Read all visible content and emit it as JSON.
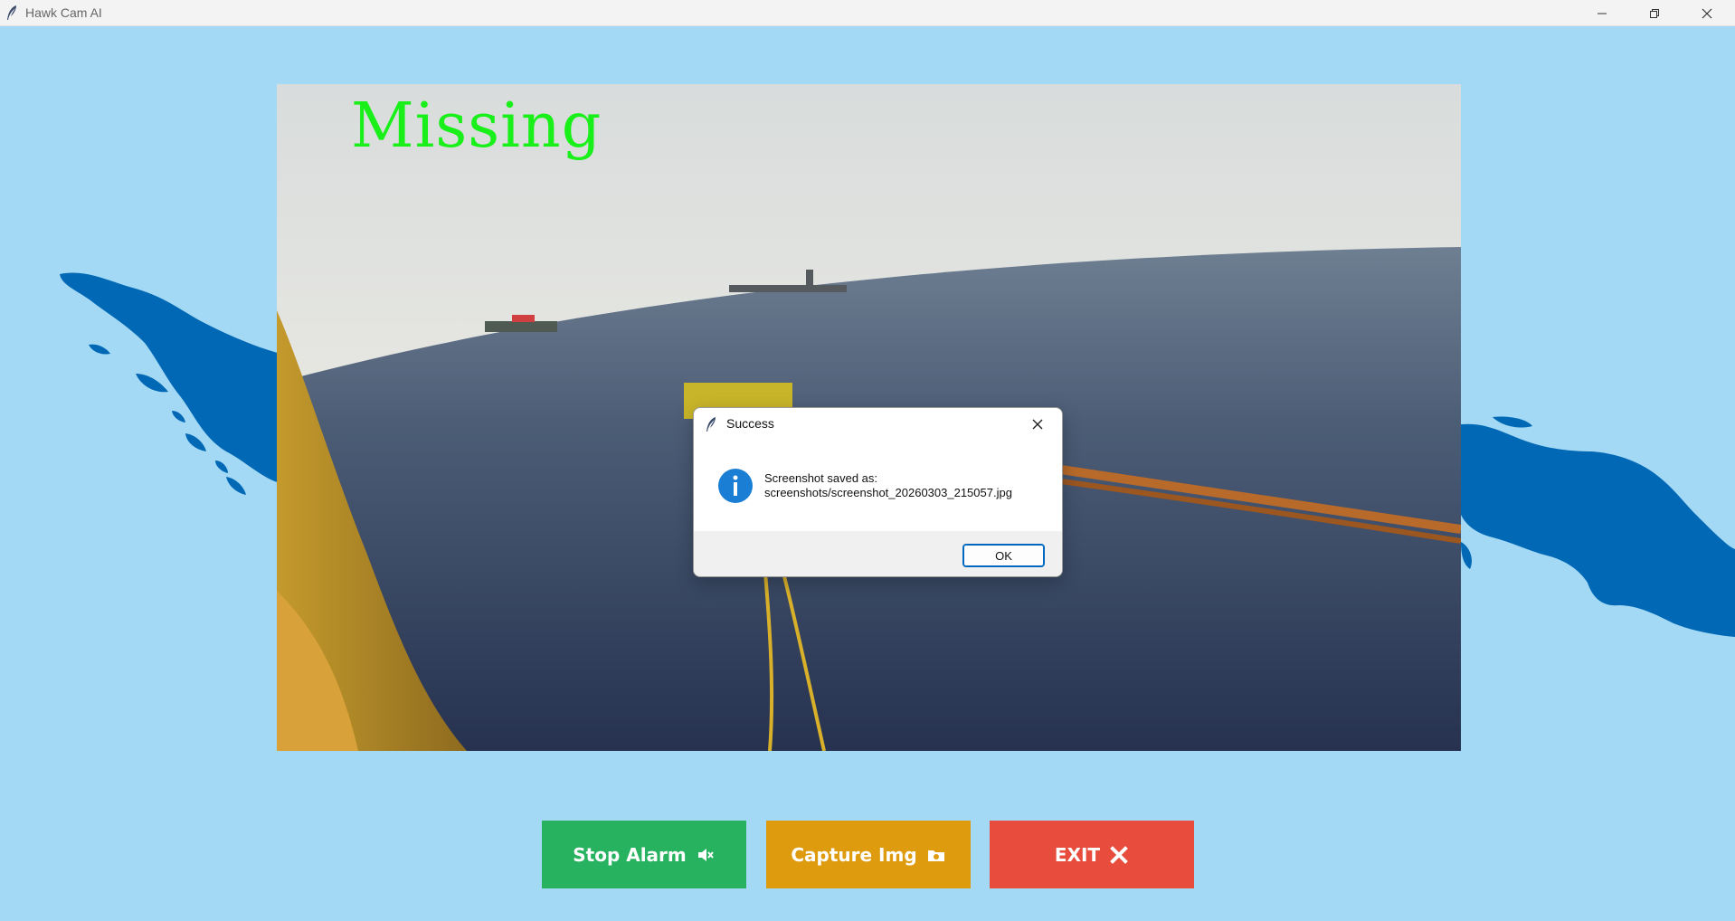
{
  "window": {
    "title": "Hawk Cam AI",
    "app_icon": "feather-icon",
    "controls": [
      "minimize-icon",
      "restore-icon",
      "close-icon"
    ]
  },
  "video": {
    "status_text": "Missing",
    "status_color": "#19f019"
  },
  "buttons": {
    "stop_alarm": {
      "label": "Stop Alarm",
      "icon": "speaker-muted-icon",
      "color": "#27b25f"
    },
    "capture_img": {
      "label": "Capture Img",
      "icon": "camera-folder-icon",
      "color": "#de9b0e"
    },
    "exit": {
      "label": "EXIT",
      "icon": "x-icon",
      "color": "#e74c3c"
    }
  },
  "dialog": {
    "title": "Success",
    "icon": "info-icon",
    "message_line1": "Screenshot saved as:",
    "message_line2": "screenshots/screenshot_20260303_215057.jpg",
    "ok_label": "OK"
  },
  "colors": {
    "background": "#a3d9f5",
    "islands": "#0068b5"
  }
}
